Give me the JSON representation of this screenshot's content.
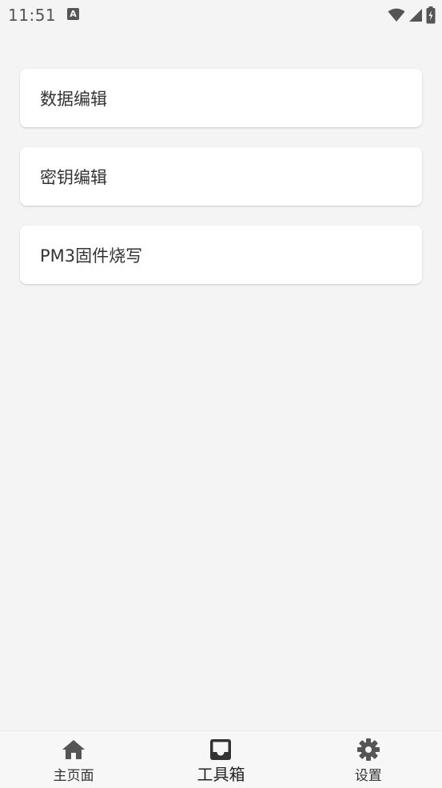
{
  "status_bar": {
    "time": "11:51",
    "badge": "A"
  },
  "cards": [
    {
      "label": "数据编辑"
    },
    {
      "label": "密钥编辑"
    },
    {
      "label": "PM3固件烧写"
    }
  ],
  "bottom_nav": {
    "items": [
      {
        "label": "主页面",
        "icon": "home-icon"
      },
      {
        "label": "工具箱",
        "icon": "toolbox-icon"
      },
      {
        "label": "设置",
        "icon": "gear-icon"
      }
    ],
    "active_index": 1
  },
  "colors": {
    "background": "#f4f4f4",
    "card": "#ffffff",
    "icon": "#555555"
  }
}
